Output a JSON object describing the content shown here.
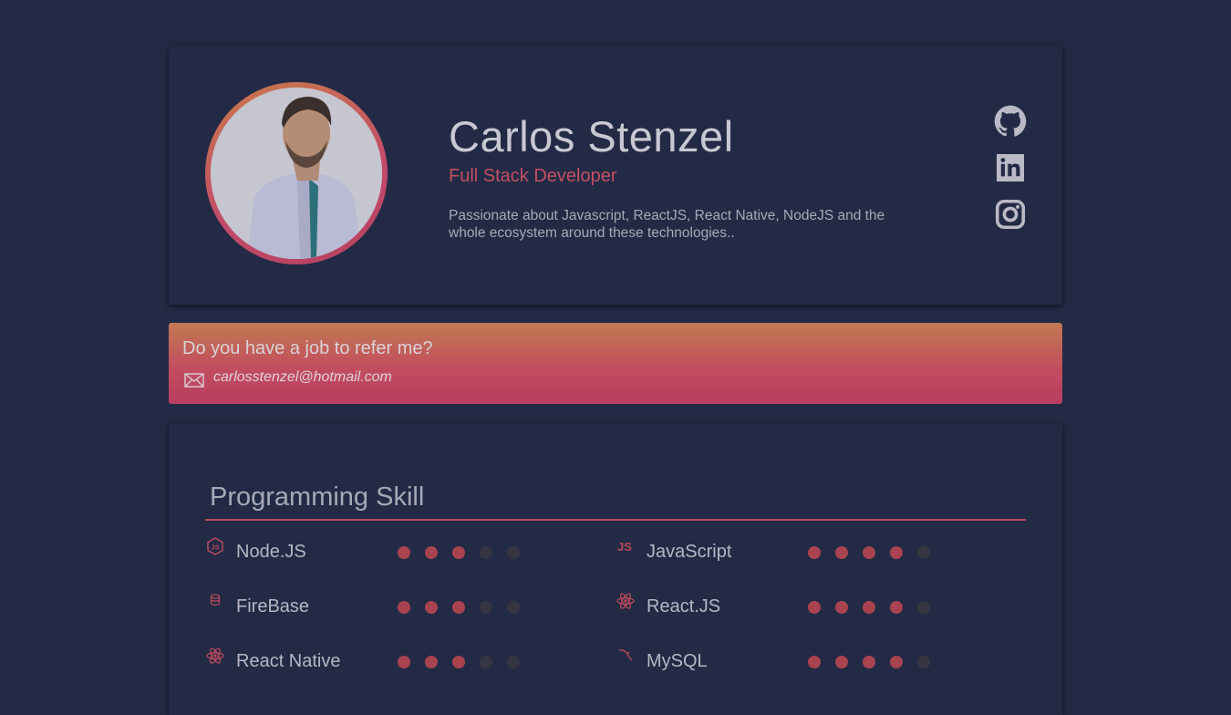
{
  "profile": {
    "name": "Carlos Stenzel",
    "role": "Full Stack Developer",
    "bio": "Passionate about Javascript, ReactJS, React Native, NodeJS and the whole ecosystem around these technologies..",
    "social": [
      {
        "name": "github-icon"
      },
      {
        "name": "linkedin-icon"
      },
      {
        "name": "instagram-icon"
      }
    ]
  },
  "contact": {
    "question": "Do you have a job to refer me?",
    "email": "carlosstenzel@hotmail.com",
    "icon": "mail-icon"
  },
  "skills": {
    "title": "Programming Skill",
    "max_level": 5,
    "left": [
      {
        "label": "Node.JS",
        "level": 3,
        "icon": "nodejs-icon"
      },
      {
        "label": "FireBase",
        "level": 3,
        "icon": "firebase-icon"
      },
      {
        "label": "React Native",
        "level": 3,
        "icon": "react-native-icon"
      }
    ],
    "right": [
      {
        "label": "JavaScript",
        "level": 4,
        "icon": "javascript-icon",
        "icon_text": "JS"
      },
      {
        "label": "React.JS",
        "level": 4,
        "icon": "react-icon"
      },
      {
        "label": "MySQL",
        "level": 4,
        "icon": "mysql-icon"
      }
    ]
  },
  "colors": {
    "background": "#232a45",
    "accent": "#c44f62",
    "dot_filled": "#a8434f",
    "dot_empty": "#353641"
  }
}
